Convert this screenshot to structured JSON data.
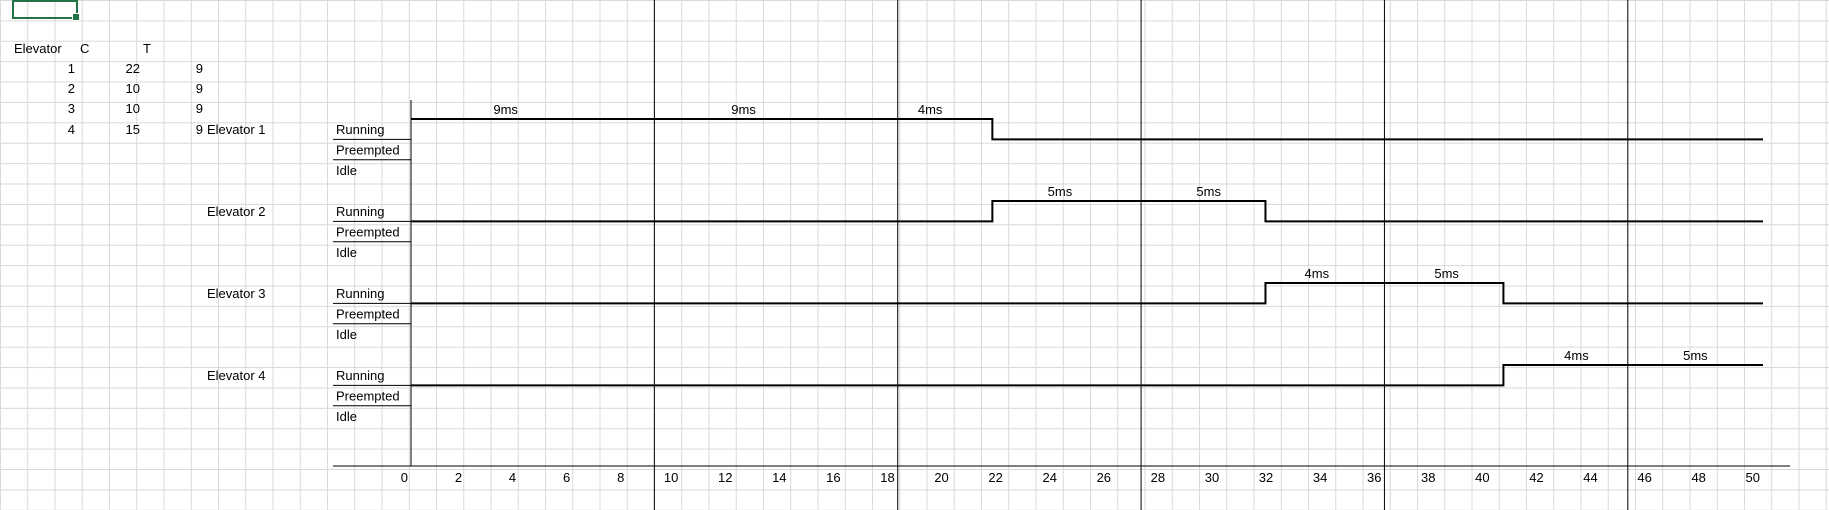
{
  "table": {
    "headers": [
      "Elevator",
      "C",
      "T"
    ],
    "rows": [
      {
        "elevator": "1",
        "c": "22",
        "t": "9"
      },
      {
        "elevator": "2",
        "c": "10",
        "t": "9"
      },
      {
        "elevator": "3",
        "c": "10",
        "t": "9"
      },
      {
        "elevator": "4",
        "c": "15",
        "t": "9"
      }
    ]
  },
  "chart_data": {
    "type": "timing-diagram",
    "state_labels": [
      "Running",
      "Preempted",
      "Idle"
    ],
    "x": [
      0,
      2,
      4,
      6,
      8,
      10,
      12,
      14,
      16,
      18,
      20,
      22,
      24,
      26,
      28,
      30,
      32,
      34,
      36,
      38,
      40,
      42,
      44,
      46,
      48,
      50
    ],
    "xlim": [
      0,
      50
    ],
    "vertical_markers": [
      9,
      18,
      27,
      36,
      45
    ],
    "series": [
      {
        "name": "Elevator 1",
        "segments": [
          {
            "state": "Running",
            "start": 0,
            "end": 21.5
          },
          {
            "state": "Preempted",
            "start": 21.5,
            "end": 50
          }
        ],
        "annotations": [
          {
            "text": "9ms",
            "x": 3.5
          },
          {
            "text": "9ms",
            "x": 12.3
          },
          {
            "text": "4ms",
            "x": 19.2
          }
        ]
      },
      {
        "name": "Elevator 2",
        "segments": [
          {
            "state": "Preempted",
            "start": 0,
            "end": 21.5
          },
          {
            "state": "Running",
            "start": 21.5,
            "end": 31.6
          },
          {
            "state": "Preempted",
            "start": 31.6,
            "end": 50
          }
        ],
        "annotations": [
          {
            "text": "5ms",
            "x": 24
          },
          {
            "text": "5ms",
            "x": 29.5
          }
        ]
      },
      {
        "name": "Elevator 3",
        "segments": [
          {
            "state": "Preempted",
            "start": 0,
            "end": 31.6
          },
          {
            "state": "Running",
            "start": 31.6,
            "end": 40.4
          },
          {
            "state": "Preempted",
            "start": 40.4,
            "end": 50
          }
        ],
        "annotations": [
          {
            "text": "4ms",
            "x": 33.5
          },
          {
            "text": "5ms",
            "x": 38.3
          }
        ]
      },
      {
        "name": "Elevator 4",
        "segments": [
          {
            "state": "Preempted",
            "start": 0,
            "end": 40.4
          },
          {
            "state": "Running",
            "start": 40.4,
            "end": 50
          }
        ],
        "annotations": [
          {
            "text": "4ms",
            "x": 43.1
          },
          {
            "text": "5ms",
            "x": 47.5
          }
        ]
      }
    ]
  }
}
